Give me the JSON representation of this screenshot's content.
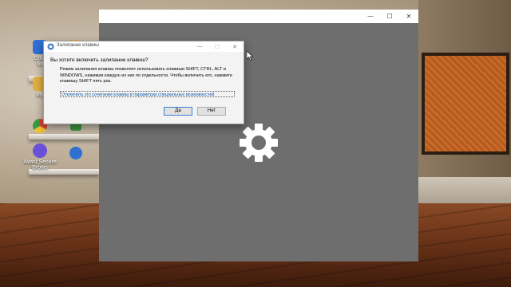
{
  "desktop": {
    "icons": [
      {
        "label": "Cour\nSo",
        "icon": "app-shortcut-icon",
        "color": "#2f6fd6"
      },
      {
        "label": "My",
        "icon": "folder-icon",
        "color": "#e0b040"
      },
      {
        "label": "",
        "icon": "chrome-icon",
        "color": "#dd4433"
      },
      {
        "label": "Avast Secure\nBrows",
        "icon": "avast-browser-icon",
        "color": "#6a4fd8"
      }
    ],
    "partial_icons": [
      {
        "label": "",
        "icon": "app-shortcut-icon",
        "color": "#e8b030"
      },
      {
        "label": "",
        "icon": "app-shortcut-icon",
        "color": "#3f9a3f"
      },
      {
        "label": "",
        "icon": "app-shortcut-icon",
        "color": "#3070d0"
      }
    ]
  },
  "app_window": {
    "background": "#6e6e6e",
    "controls": {
      "minimize": "—",
      "maximize": "☐",
      "close": "✕"
    },
    "center_icon": "gear-icon"
  },
  "dialog": {
    "title": "Залипание клавиш",
    "question": "Вы хотите включить залипание клавиш?",
    "body": "Режим залипания клавиш позволяет использовать клавиши SHIFT, CTRL, ALT и WINDOWS, нажимая каждую из них по отдельности. Чтобы включить его, нажмите клавишу SHIFT пять раз.",
    "link": "Отключить это сочетание клавиш в параметрах специальных возможностей",
    "yes_label": "Да",
    "no_label": "Нет",
    "controls": {
      "minimize": "—",
      "maximize": "☐",
      "close": "✕"
    }
  }
}
